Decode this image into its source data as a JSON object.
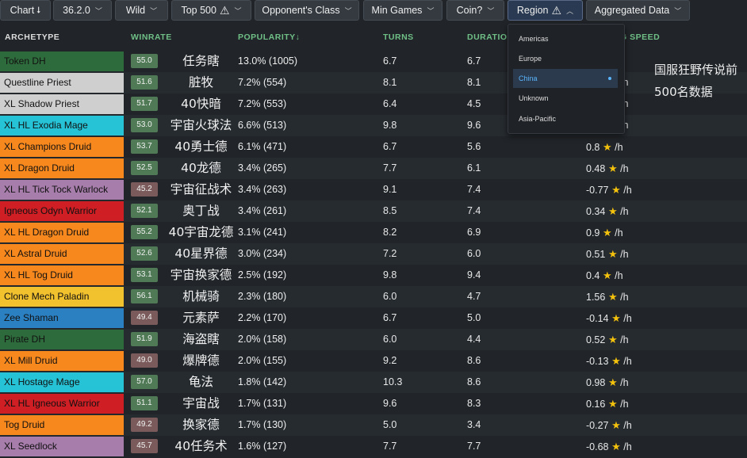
{
  "toolbar": {
    "chart": {
      "label": "Chart",
      "icon": "sort-arrow-icon"
    },
    "version": {
      "label": "36.2.0"
    },
    "format": {
      "label": "Wild"
    },
    "rank": {
      "label": "Top 500",
      "icon": "warning-icon"
    },
    "opponent": {
      "label": "Opponent's Class"
    },
    "min_games": {
      "label": "Min Games"
    },
    "coin": {
      "label": "Coin?"
    },
    "region": {
      "label": "Region",
      "icon": "warning-icon"
    },
    "aggregated": {
      "label": "Aggregated Data"
    }
  },
  "columns": {
    "archetype": "ARCHETYPE",
    "winrate": "WINRATE",
    "popularity": "POPULARITY↓",
    "turns": "TURNS",
    "duration": "DURATIO",
    "speed": "G SPEED"
  },
  "region_dropdown": {
    "options": [
      "Americas",
      "Europe",
      "China",
      "Unknown",
      "Asia-Pacific"
    ],
    "selected": "China"
  },
  "side_note": {
    "line1": "国服狂野传说前",
    "line2": "500名数据"
  },
  "colors": {
    "demon_hunter": "#2e6b3c",
    "priest": "#cfcfcf",
    "mage": "#26c3d6",
    "druid": "#f7881d",
    "warlock": "#a77dab",
    "warrior": "#cf1e24",
    "paladin": "#f2c12e",
    "shaman": "#2b80c2",
    "badge_high": "#4f7a55",
    "badge_low": "#7a5a5a",
    "star": "#f4c20d",
    "header_green": "#6fbf87"
  },
  "rows": [
    {
      "archetype": "Token DH",
      "class_color": "#2e6b3c",
      "dark_text": true,
      "winrate": "55.0",
      "cn": "任务瞎",
      "popularity": "13.0% (1005)",
      "turns": "6.7",
      "duration": "6.7",
      "speed": ""
    },
    {
      "archetype": "Questline Priest",
      "class_color": "#cfcfcf",
      "winrate": "51.6",
      "cn": "脏牧",
      "popularity": "7.2% (554)",
      "turns": "8.1",
      "duration": "8.1",
      "speed": "/h"
    },
    {
      "archetype": "XL Shadow Priest",
      "class_color": "#cfcfcf",
      "winrate": "51.7",
      "cn": "40快暗",
      "popularity": "7.2% (553)",
      "turns": "6.4",
      "duration": "4.5",
      "speed": "/h"
    },
    {
      "archetype": "XL HL Exodia Mage",
      "class_color": "#26c3d6",
      "winrate": "53.0",
      "cn": "宇宙火球法",
      "popularity": "6.6% (513)",
      "turns": "9.8",
      "duration": "9.6",
      "speed": "/h"
    },
    {
      "archetype": "XL Champions Druid",
      "class_color": "#f7881d",
      "winrate": "53.7",
      "cn": "40勇士德",
      "popularity": "6.1% (471)",
      "turns": "6.7",
      "duration": "5.6",
      "speed": "0.8"
    },
    {
      "archetype": "XL Dragon Druid",
      "class_color": "#f7881d",
      "winrate": "52.5",
      "cn": "40龙德",
      "popularity": "3.4% (265)",
      "turns": "7.7",
      "duration": "6.1",
      "speed": "0.48"
    },
    {
      "archetype": "XL HL Tick Tock Warlock",
      "class_color": "#a77dab",
      "winrate": "45.2",
      "cn": "宇宙征战术",
      "popularity": "3.4% (263)",
      "turns": "9.1",
      "duration": "7.4",
      "speed": "-0.77"
    },
    {
      "archetype": "Igneous Odyn Warrior",
      "class_color": "#cf1e24",
      "winrate": "52.1",
      "cn": "奥丁战",
      "popularity": "3.4% (261)",
      "turns": "8.5",
      "duration": "7.4",
      "speed": "0.34"
    },
    {
      "archetype": "XL HL Dragon Druid",
      "class_color": "#f7881d",
      "winrate": "55.2",
      "cn": "40宇宙龙德",
      "popularity": "3.1% (241)",
      "turns": "8.2",
      "duration": "6.9",
      "speed": "0.9"
    },
    {
      "archetype": "XL Astral Druid",
      "class_color": "#f7881d",
      "winrate": "52.6",
      "cn": "40星界德",
      "popularity": "3.0% (234)",
      "turns": "7.2",
      "duration": "6.0",
      "speed": "0.51"
    },
    {
      "archetype": "XL HL Tog Druid",
      "class_color": "#f7881d",
      "winrate": "53.1",
      "cn": "宇宙换家德",
      "popularity": "2.5% (192)",
      "turns": "9.8",
      "duration": "9.4",
      "speed": "0.4"
    },
    {
      "archetype": "Clone Mech Paladin",
      "class_color": "#f2c12e",
      "winrate": "56.1",
      "cn": "机械骑",
      "popularity": "2.3% (180)",
      "turns": "6.0",
      "duration": "4.7",
      "speed": "1.56"
    },
    {
      "archetype": "Zee Shaman",
      "class_color": "#2b80c2",
      "winrate": "49.4",
      "cn": "元素萨",
      "popularity": "2.2% (170)",
      "turns": "6.7",
      "duration": "5.0",
      "speed": "-0.14"
    },
    {
      "archetype": "Pirate DH",
      "class_color": "#2e6b3c",
      "winrate": "51.9",
      "cn": "海盗瞎",
      "popularity": "2.0% (158)",
      "turns": "6.0",
      "duration": "4.4",
      "speed": "0.52"
    },
    {
      "archetype": "XL Mill Druid",
      "class_color": "#f7881d",
      "winrate": "49.0",
      "cn": "爆牌德",
      "popularity": "2.0% (155)",
      "turns": "9.2",
      "duration": "8.6",
      "speed": "-0.13"
    },
    {
      "archetype": "XL Hostage Mage",
      "class_color": "#26c3d6",
      "winrate": "57.0",
      "cn": "龟法",
      "popularity": "1.8% (142)",
      "turns": "10.3",
      "duration": "8.6",
      "speed": "0.98"
    },
    {
      "archetype": "XL HL Igneous Warrior",
      "class_color": "#cf1e24",
      "winrate": "51.1",
      "cn": "宇宙战",
      "popularity": "1.7% (131)",
      "turns": "9.6",
      "duration": "8.3",
      "speed": "0.16"
    },
    {
      "archetype": "Tog Druid",
      "class_color": "#f7881d",
      "winrate": "49.2",
      "cn": "换家德",
      "popularity": "1.7% (130)",
      "turns": "5.0",
      "duration": "3.4",
      "speed": "-0.27"
    },
    {
      "archetype": "XL Seedlock",
      "class_color": "#a77dab",
      "winrate": "45.7",
      "cn": "40任务术",
      "popularity": "1.6% (127)",
      "turns": "7.7",
      "duration": "7.7",
      "speed": "-0.68"
    }
  ]
}
